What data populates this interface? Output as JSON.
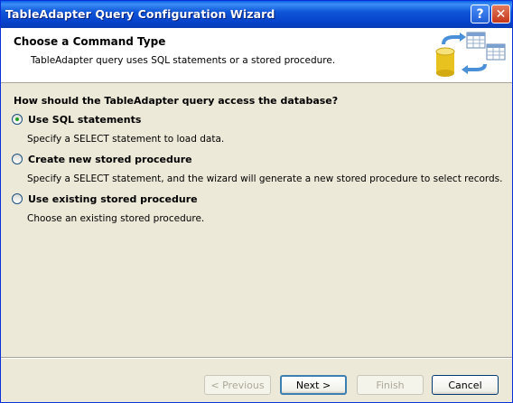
{
  "window": {
    "title": "TableAdapter Query Configuration Wizard"
  },
  "titlebar": {
    "help_label": "?",
    "close_label": "✕"
  },
  "header": {
    "title": "Choose a Command Type",
    "subtitle": "TableAdapter query uses SQL statements or a stored procedure."
  },
  "question": "How should the TableAdapter query access the database?",
  "options": [
    {
      "label": "Use SQL statements",
      "description": "Specify a SELECT statement to load data.",
      "selected": true
    },
    {
      "label": "Create new stored procedure",
      "description": "Specify a SELECT statement, and the wizard will generate a new stored procedure to select records.",
      "selected": false
    },
    {
      "label": "Use existing stored procedure",
      "description": "Choose an existing stored procedure.",
      "selected": false
    }
  ],
  "buttons": {
    "previous": "< Previous",
    "next": "Next >",
    "finish": "Finish",
    "cancel": "Cancel"
  }
}
